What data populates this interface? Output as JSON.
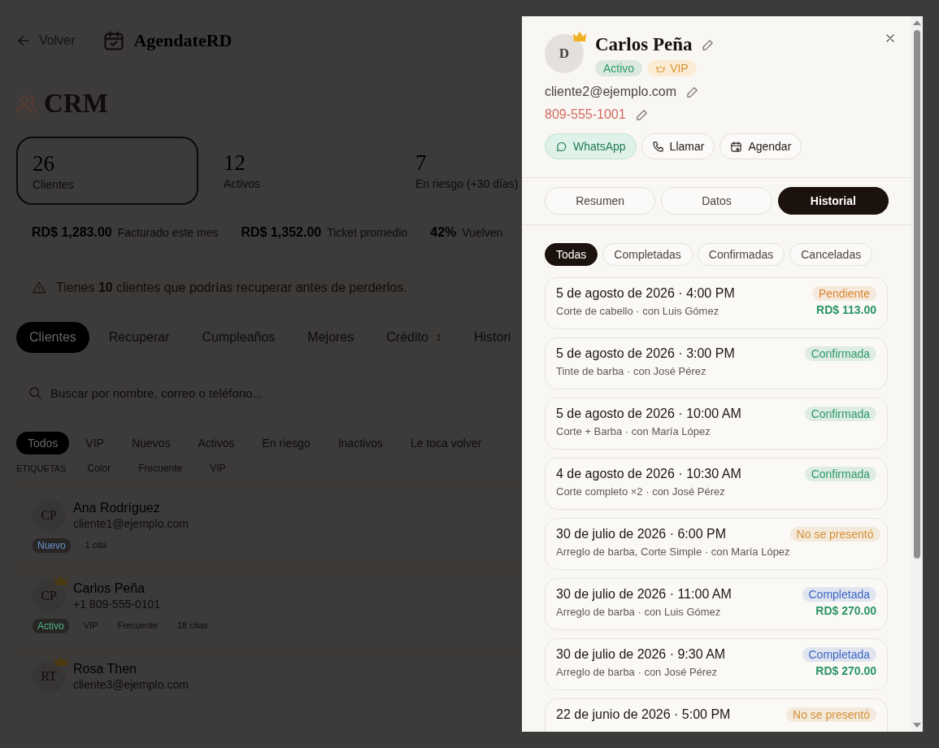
{
  "header": {
    "back": "Volver",
    "brand": "AgendateRD"
  },
  "page_title": "CRM",
  "stats": [
    {
      "value": "26",
      "label": "Clientes",
      "selected": true
    },
    {
      "value": "12",
      "label": "Activos",
      "selected": false
    },
    {
      "value": "7",
      "label": "En riesgo (+30 días)",
      "selected": false
    }
  ],
  "metrics": [
    {
      "value": "RD$ 1,283.00",
      "label": "Facturado este mes"
    },
    {
      "value": "RD$ 1,352.00",
      "label": "Ticket promedio"
    },
    {
      "value": "42%",
      "label": "Vuelven"
    }
  ],
  "alert": "Tienes **10** clientes que podrías recuperar antes de perderlos.",
  "tabs": [
    {
      "label": "Clientes",
      "selected": true
    },
    {
      "label": "Recuperar",
      "selected": false
    },
    {
      "label": "Cumpleaños",
      "selected": false
    },
    {
      "label": "Mejores",
      "selected": false
    },
    {
      "label": "Crédito",
      "badge": "1",
      "selected": false
    },
    {
      "label": "Histori",
      "selected": false
    }
  ],
  "search": {
    "placeholder": "Buscar por nombre, correo o teléfono..."
  },
  "filters": [
    {
      "label": "Todos",
      "selected": true
    },
    {
      "label": "VIP",
      "selected": false
    },
    {
      "label": "Nuevos",
      "selected": false
    },
    {
      "label": "Activos",
      "selected": false
    },
    {
      "label": "En riesgo",
      "selected": false
    },
    {
      "label": "Inactivos",
      "selected": false
    },
    {
      "label": "Le toca volver",
      "selected": false
    }
  ],
  "tags": {
    "label": "ETIQUETAS",
    "items": [
      "Color",
      "Frecuente",
      "VIP"
    ]
  },
  "clients": [
    {
      "initials": "CP",
      "name": "Ana Rodríguez",
      "contact": "cliente1@ejemplo.com",
      "vip": false,
      "chips": [
        {
          "text": "Nuevo",
          "kind": "status",
          "color": "#6a92d0"
        },
        {
          "text": "1 cita",
          "kind": "count"
        }
      ]
    },
    {
      "initials": "CP",
      "name": "Carlos Peña",
      "contact": "+1 809-555-0101",
      "vip": true,
      "chips": [
        {
          "text": "Activo",
          "kind": "status",
          "color": "#4fb088"
        },
        {
          "text": "VIP",
          "kind": "tag"
        },
        {
          "text": "Frecuente",
          "kind": "tag"
        },
        {
          "text": "18 citas",
          "kind": "count"
        }
      ]
    },
    {
      "initials": "RT",
      "name": "Rosa Then",
      "contact": "cliente3@ejemplo.com",
      "vip": true
    }
  ],
  "drawer": {
    "initial": "D",
    "vip": true,
    "name": "Carlos Peña",
    "badges": [
      {
        "text": "Activo",
        "kind": "status",
        "color": "#2f9b6e"
      },
      {
        "text": "VIP",
        "kind": "vip"
      }
    ],
    "email": "cliente2@ejemplo.com",
    "phone": "809-555-1001",
    "actions": [
      {
        "label": "WhatsApp",
        "kind": "whatsapp"
      },
      {
        "label": "Llamar",
        "kind": "call"
      },
      {
        "label": "Agendar",
        "kind": "schedule"
      }
    ],
    "tabs": [
      {
        "label": "Resumen",
        "selected": false
      },
      {
        "label": "Datos",
        "selected": false
      },
      {
        "label": "Historial",
        "selected": true
      }
    ],
    "filters": [
      {
        "label": "Todas",
        "selected": true
      },
      {
        "label": "Completadas",
        "selected": false
      },
      {
        "label": "Confirmadas",
        "selected": false
      },
      {
        "label": "Canceladas",
        "selected": false
      }
    ],
    "appointments": [
      {
        "datetime": "5 de agosto de 2026 · 4:00 PM",
        "detail": "Corte de cabello · con Luis Gómez",
        "status": "Pendiente",
        "color": "#d9852f",
        "amount": "RD$ 113.00"
      },
      {
        "datetime": "5 de agosto de 2026 · 3:00 PM",
        "detail": "Tinte de barba · con José Pérez",
        "status": "Confirmada",
        "color": "#2e9b6a"
      },
      {
        "datetime": "5 de agosto de 2026 · 10:00 AM",
        "detail": "Corte + Barba · con María López",
        "status": "Confirmada",
        "color": "#2e9b6a"
      },
      {
        "datetime": "4 de agosto de 2026 · 10:30 AM",
        "detail": "Corte completo ×2 · con José Pérez",
        "status": "Confirmada",
        "color": "#2e9b6a"
      },
      {
        "datetime": "30 de julio de 2026 · 6:00 PM",
        "detail": "Arreglo de barba, Corte Simple · con María López",
        "status": "No se presentó",
        "color": "#d49035"
      },
      {
        "datetime": "30 de julio de 2026 · 11:00 AM",
        "detail": "Arreglo de barba · con Luis Gómez",
        "status": "Completada",
        "color": "#3d67c6",
        "amount": "RD$ 270.00"
      },
      {
        "datetime": "30 de julio de 2026 · 9:30 AM",
        "detail": "Arreglo de barba · con José Pérez",
        "status": "Completada",
        "color": "#3d67c6",
        "amount": "RD$ 270.00"
      },
      {
        "datetime": "22 de junio de 2026 · 5:00 PM",
        "status": "No se presentó",
        "color": "#d49035"
      }
    ]
  }
}
